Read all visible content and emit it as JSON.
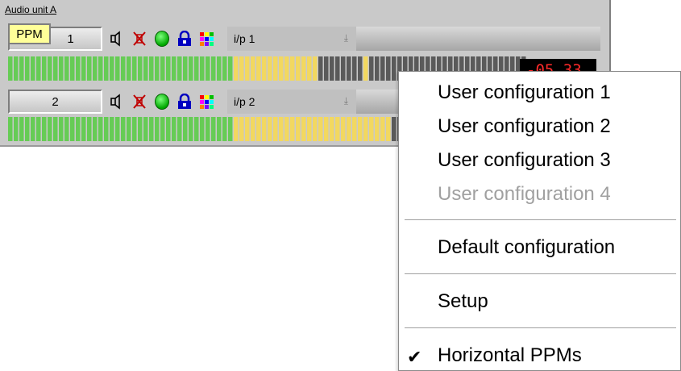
{
  "unit": {
    "title": "Audio unit A",
    "tooltip": "PPM",
    "channels": [
      {
        "number": "1",
        "input": "i/p 1",
        "readout": "-05.33"
      },
      {
        "number": "2",
        "input": "i/p 2"
      }
    ],
    "icons": [
      "speaker-icon",
      "mute-icon",
      "status-light-icon",
      "lock-icon",
      "color-palette-icon"
    ],
    "colors": {
      "green": "#66cc55",
      "yellow": "#f2d860",
      "dark": "#5a5a5a",
      "readout_red": "#ff2a2a"
    }
  },
  "context_menu": {
    "items": [
      {
        "label": "User configuration 1",
        "enabled": true
      },
      {
        "label": "User configuration 2",
        "enabled": true
      },
      {
        "label": "User configuration 3",
        "enabled": true
      },
      {
        "label": "User configuration 4",
        "enabled": false
      },
      {
        "label": "Default configuration",
        "enabled": true
      },
      {
        "label": "Setup",
        "enabled": true
      },
      {
        "label": "Horizontal PPMs",
        "enabled": true,
        "checked": true
      }
    ],
    "check_glyph": "✔"
  }
}
